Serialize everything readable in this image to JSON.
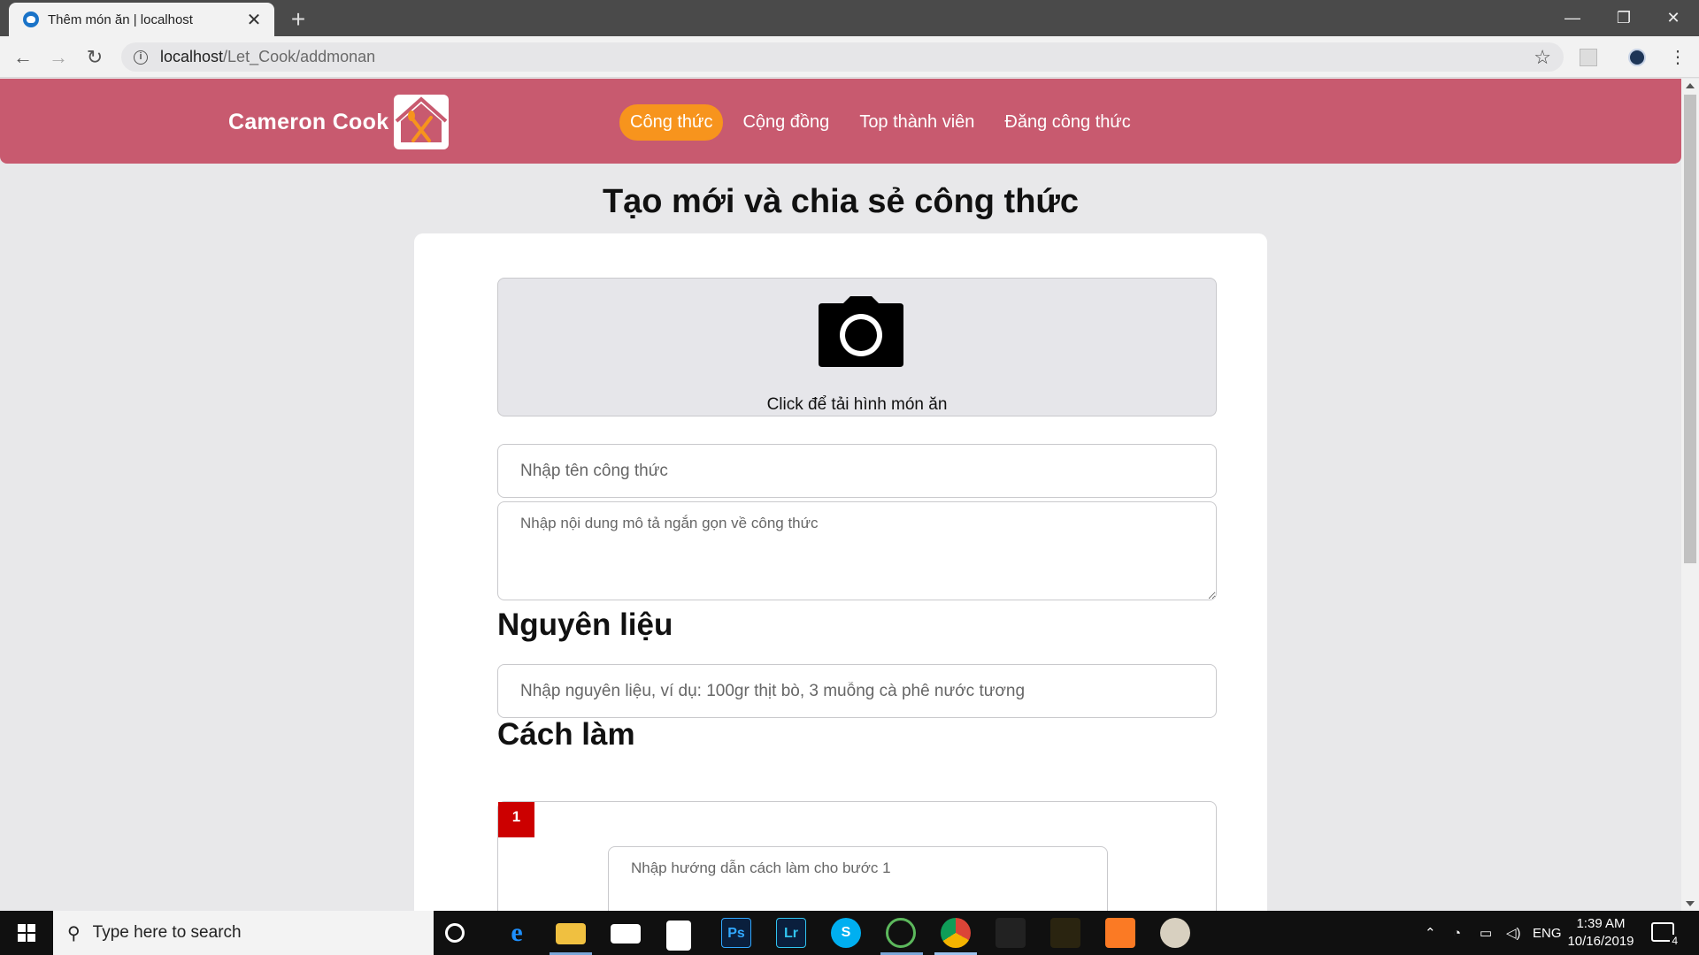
{
  "browser": {
    "tab_title": "Thêm món ăn | localhost",
    "tab_close": "✕",
    "new_tab": "+",
    "url_host": "localhost",
    "url_path": "/Let_Cook/addmonan",
    "window_minimize": "—",
    "window_restore": "❐",
    "window_close": "✕"
  },
  "header": {
    "brand": "Cameron Cook",
    "nav": [
      {
        "label": "Công thức",
        "active": true
      },
      {
        "label": "Cộng đồng",
        "active": false
      },
      {
        "label": "Top thành viên",
        "active": false
      },
      {
        "label": "Đăng công thức",
        "active": false
      }
    ],
    "colors": {
      "bar": "#c85a6f",
      "active_pill": "#f7941d"
    }
  },
  "page": {
    "title": "Tạo mới và chia sẻ công thức",
    "upload_label": "Click để tải hình món ăn",
    "recipe_name_placeholder": "Nhập tên công thức",
    "description_placeholder": "Nhập nội dung mô tả ngắn gọn về công thức",
    "ingredients_heading": "Nguyên liệu",
    "ingredients_placeholder": "Nhập nguyên liệu, ví dụ: 100gr thịt bò, 3 muỗng cà phê nước tương",
    "steps_heading": "Cách làm",
    "steps": [
      {
        "number": "1",
        "placeholder": "Nhập hướng dẫn cách làm cho bước 1"
      }
    ]
  },
  "taskbar": {
    "search_placeholder": "Type here to search",
    "language": "ENG",
    "time": "1:39 AM",
    "date": "10/16/2019",
    "notification_count": "4",
    "apps": [
      "cortana-icon",
      "edge-icon",
      "file-explorer-icon",
      "mail-icon",
      "store-icon",
      "photoshop-icon",
      "lightroom-icon",
      "skype-icon",
      "coccoc-icon",
      "chrome-icon",
      "garena-icon",
      "league-icon",
      "xampp-icon",
      "paint-icon"
    ],
    "app_labels": {
      "photoshop": "Ps",
      "lightroom": "Lr",
      "skype": "S"
    }
  }
}
